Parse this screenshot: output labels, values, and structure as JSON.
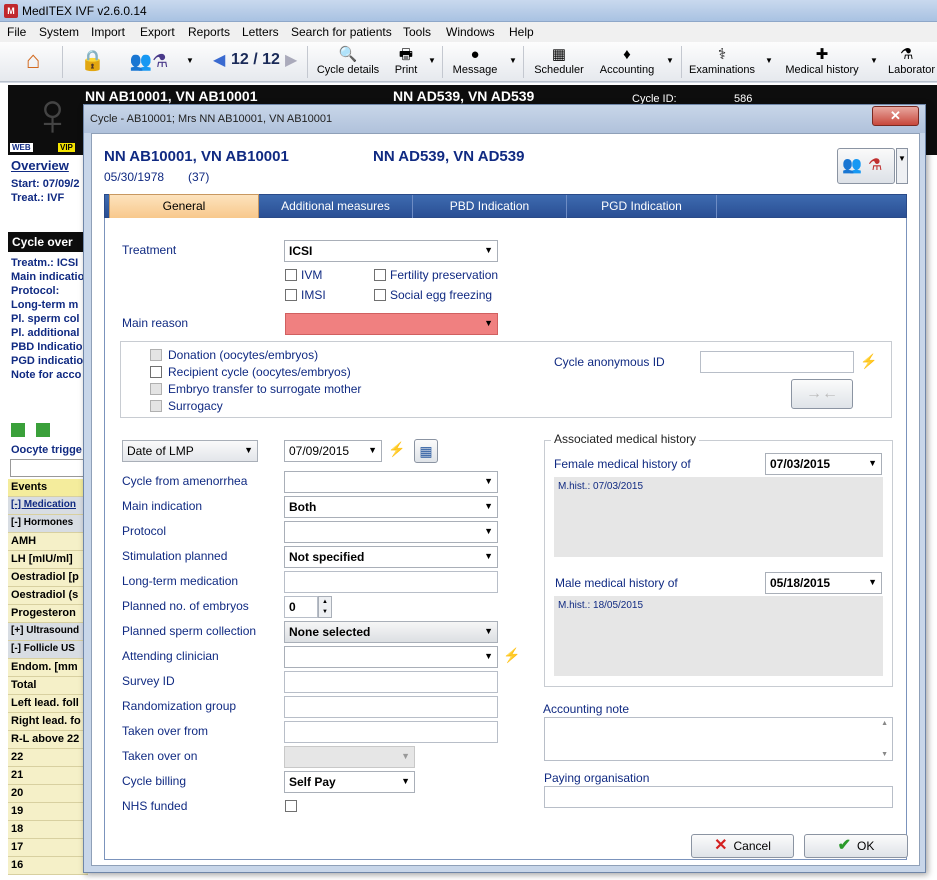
{
  "app": {
    "title": "MedITEX IVF v2.6.0.14"
  },
  "menu": [
    "File",
    "System",
    "Import",
    "Export",
    "Reports",
    "Letters",
    "Search for patients",
    "Tools",
    "Windows",
    "Help"
  ],
  "toolbar": {
    "record_counter": "12 / 12",
    "cycle_details": "Cycle details",
    "print": "Print",
    "message": "Message",
    "scheduler": "Scheduler",
    "accounting": "Accounting",
    "examinations": "Examinations",
    "medical_history": "Medical history",
    "laboratory": "Laborator"
  },
  "background": {
    "patient_female": "NN AB10001, VN AB10001",
    "patient_male": "NN AD539, VN AD539",
    "cycle_id_label": "Cycle ID:",
    "cycle_id": "586",
    "web": "WEB",
    "vip": "VIP",
    "overview": "Overview",
    "start": "Start: 07/09/2",
    "treat": "Treat.: IVF",
    "cycle_overview": "Cycle over",
    "summary": [
      "Treatm.: ICSI",
      "Main indicatio",
      "Protocol:",
      "Long-term m",
      "Pl. sperm col",
      "Pl. additional",
      "PBD Indicatio",
      "PGD indicatio",
      "Note for acco"
    ],
    "oocyte": "Oocyte trigge",
    "events": "Events",
    "medication": "[-] Medication",
    "hormones": "[-] Hormones",
    "rows": [
      "AMH",
      "LH [mIU/ml]",
      "Oestradiol [p",
      "Oestradiol (s",
      "Progesteron"
    ],
    "ultrasound": "[+] Ultrasound",
    "follicle": "[-] Follicle US",
    "rows2": [
      "Endom. [mm",
      "Total",
      "Left lead. foll",
      "Right lead. fo",
      "R-L above 22",
      "22",
      "21",
      "20",
      "19",
      "18",
      "17",
      "16"
    ]
  },
  "dialog": {
    "title": "Cycle - AB10001; Mrs NN AB10001, VN AB10001",
    "close": "✕",
    "female_name": "NN AB10001, VN AB10001",
    "female_dob": "05/30/1978",
    "female_age": "(37)",
    "male_name": "NN AD539, VN AD539",
    "tabs": [
      "General",
      "Additional measures",
      "PBD Indication",
      "PGD Indication"
    ],
    "treatment_label": "Treatment",
    "treatment_value": "ICSI",
    "ivm": "IVM",
    "imsi": "IMSI",
    "fertility": "Fertility preservation",
    "social": "Social egg freezing",
    "main_reason_label": "Main reason",
    "donation": "Donation (oocytes/embryos)",
    "recipient": "Recipient cycle (oocytes/embryos)",
    "surrogate": "Embryo transfer to surrogate mother",
    "surrogacy": "Surrogacy",
    "anon_label": "Cycle anonymous ID",
    "date_type": "Date of LMP",
    "date_value": "07/09/2015",
    "amenorrhea_label": "Cycle from amenorrhea",
    "main_indication_label": "Main indication",
    "main_indication_value": "Both",
    "protocol_label": "Protocol",
    "stimulation_label": "Stimulation planned",
    "stimulation_value": "Not specified",
    "longterm_label": "Long-term medication",
    "embryos_label": "Planned no. of embryos",
    "embryos_value": "0",
    "sperm_label": "Planned sperm collection",
    "sperm_value": "None selected",
    "clinician_label": "Attending clinician",
    "survey_label": "Survey ID",
    "random_label": "Randomization group",
    "takenfrom_label": "Taken over from",
    "takenon_label": "Taken over on",
    "billing_label": "Cycle billing",
    "billing_value": "Self Pay",
    "nhs_label": "NHS funded",
    "assoc_label": "Associated medical history",
    "female_hist_label": "Female medical history of",
    "female_hist_value": "07/03/2015",
    "female_hist_note": "M.hist.: 07/03/2015",
    "male_hist_label": "Male medical history of",
    "male_hist_value": "05/18/2015",
    "male_hist_note": "M.hist.: 18/05/2015",
    "accounting_note_label": "Accounting note",
    "paying_label": "Paying organisation",
    "cancel": "Cancel",
    "ok": "OK"
  },
  "colors": {
    "accent": "#102a82",
    "required": "#f08080",
    "tab_active": "#f8c88c",
    "tab_bar": "#2a4f94"
  }
}
